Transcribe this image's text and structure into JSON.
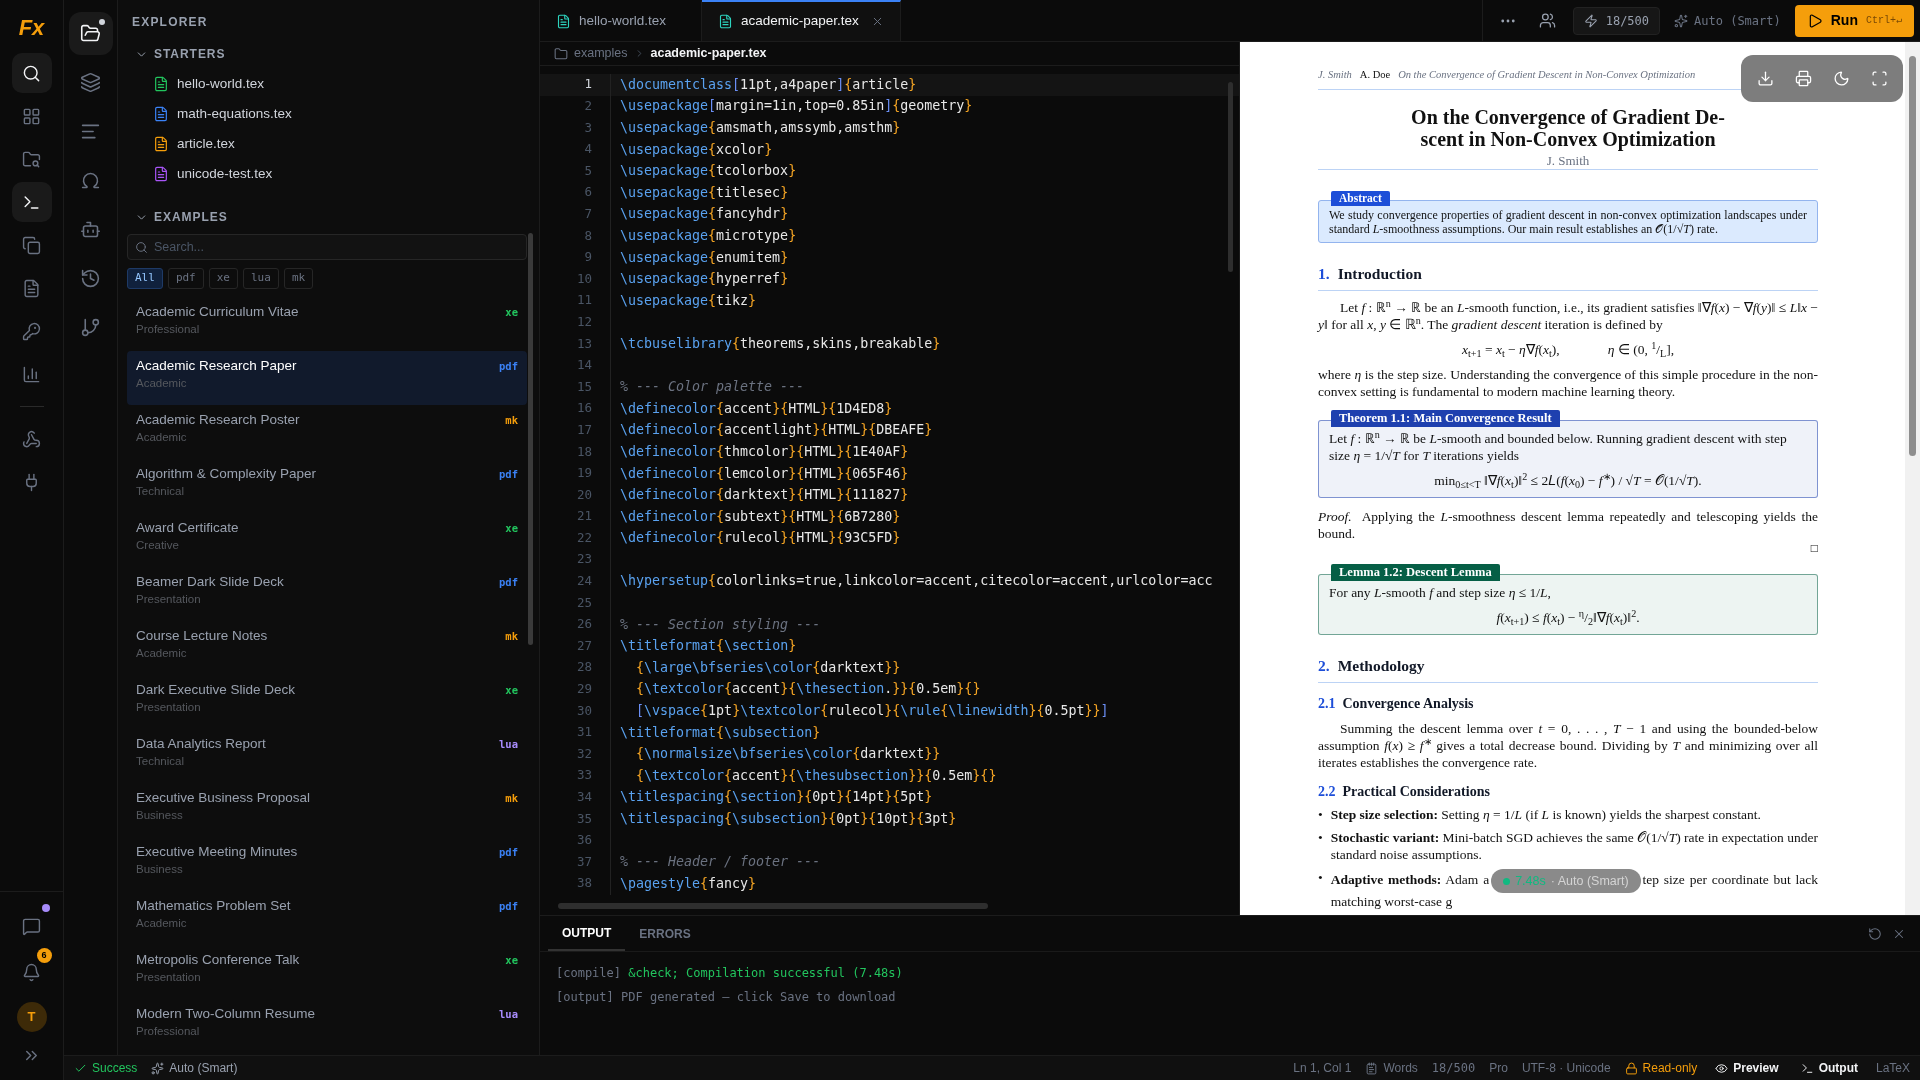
{
  "activity_bar": {
    "logo": "Fx",
    "items": [
      {
        "selected": true
      },
      {
        "selected": false
      },
      {
        "selected": false
      },
      {
        "selected": true
      },
      {
        "selected": false
      },
      {
        "selected": false
      },
      {
        "selected": false
      },
      {
        "selected": false
      },
      {
        "selected": false
      },
      {
        "selected": false
      }
    ],
    "chat_unread": true,
    "notifications": "6",
    "avatar": "T"
  },
  "side_nav": {
    "items": [
      {
        "selected": true,
        "dot": true
      },
      {
        "selected": false,
        "dot": false
      },
      {
        "selected": false,
        "dot": false
      },
      {
        "selected": false,
        "dot": false
      },
      {
        "selected": false,
        "dot": false
      },
      {
        "selected": false,
        "dot": false
      },
      {
        "selected": false,
        "dot": false
      }
    ]
  },
  "explorer": {
    "title": "EXPLORER",
    "starters": {
      "title": "STARTERS",
      "expanded": true,
      "files": [
        {
          "name": "hello-world.tex",
          "color": "#22c55e"
        },
        {
          "name": "math-equations.tex",
          "color": "#3b82f6"
        },
        {
          "name": "article.tex",
          "color": "#f59e0b"
        },
        {
          "name": "unicode-test.tex",
          "color": "#a855f7"
        }
      ]
    },
    "examples": {
      "title": "EXAMPLES",
      "expanded": true,
      "search": {
        "placeholder": "Search..."
      },
      "filters": [
        {
          "label": "All",
          "selected": true
        },
        {
          "label": "pdf",
          "selected": false
        },
        {
          "label": "xe",
          "selected": false
        },
        {
          "label": "lua",
          "selected": false
        },
        {
          "label": "mk",
          "selected": false
        }
      ],
      "items": [
        {
          "title": "Academic Curriculum Vitae",
          "category": "Professional",
          "engine": "xe",
          "color": "#22c55e",
          "selected": false
        },
        {
          "title": "Academic Research Paper",
          "category": "Academic",
          "engine": "pdf",
          "color": "#3b82f6",
          "selected": true
        },
        {
          "title": "Academic Research Poster",
          "category": "Academic",
          "engine": "mk",
          "color": "#f59e0b",
          "selected": false
        },
        {
          "title": "Algorithm & Complexity Paper",
          "category": "Technical",
          "engine": "pdf",
          "color": "#3b82f6",
          "selected": false
        },
        {
          "title": "Award Certificate",
          "category": "Creative",
          "engine": "xe",
          "color": "#22c55e",
          "selected": false
        },
        {
          "title": "Beamer Dark Slide Deck",
          "category": "Presentation",
          "engine": "pdf",
          "color": "#3b82f6",
          "selected": false
        },
        {
          "title": "Course Lecture Notes",
          "category": "Academic",
          "engine": "mk",
          "color": "#f59e0b",
          "selected": false
        },
        {
          "title": "Dark Executive Slide Deck",
          "category": "Presentation",
          "engine": "xe",
          "color": "#22c55e",
          "selected": false
        },
        {
          "title": "Data Analytics Report",
          "category": "Technical",
          "engine": "lua",
          "color": "#a78bfa",
          "selected": false
        },
        {
          "title": "Executive Business Proposal",
          "category": "Business",
          "engine": "mk",
          "color": "#f59e0b",
          "selected": false
        },
        {
          "title": "Executive Meeting Minutes",
          "category": "Business",
          "engine": "pdf",
          "color": "#3b82f6",
          "selected": false
        },
        {
          "title": "Mathematics Problem Set",
          "category": "Academic",
          "engine": "pdf",
          "color": "#3b82f6",
          "selected": false
        },
        {
          "title": "Metropolis Conference Talk",
          "category": "Presentation",
          "engine": "xe",
          "color": "#22c55e",
          "selected": false
        },
        {
          "title": "Modern Two-Column Resume",
          "category": "Professional",
          "engine": "lua",
          "color": "#a78bfa",
          "selected": false
        }
      ]
    }
  },
  "tabs": [
    {
      "label": "hello-world.tex",
      "selected": false,
      "closable": false
    },
    {
      "label": "academic-paper.tex",
      "selected": true,
      "closable": true
    }
  ],
  "toolbar": {
    "usage": "18/500",
    "mode": "Auto (Smart)",
    "run": {
      "label": "Run",
      "shortcut": "Ctrl+↵"
    }
  },
  "breadcrumb": [
    "examples",
    "academic-paper.tex"
  ],
  "editor": {
    "lines": [
      {
        "n": "1",
        "current": true,
        "code": "\\documentclass[11pt,a4paper]{article}"
      },
      {
        "n": "2",
        "current": false,
        "code": "\\usepackage[margin=1in,top=0.85in]{geometry}"
      },
      {
        "n": "3",
        "current": false,
        "code": "\\usepackage{amsmath,amssymb,amsthm}"
      },
      {
        "n": "4",
        "current": false,
        "code": "\\usepackage{xcolor}"
      },
      {
        "n": "5",
        "current": false,
        "code": "\\usepackage{tcolorbox}"
      },
      {
        "n": "6",
        "current": false,
        "code": "\\usepackage{titlesec}"
      },
      {
        "n": "7",
        "current": false,
        "code": "\\usepackage{fancyhdr}"
      },
      {
        "n": "8",
        "current": false,
        "code": "\\usepackage{microtype}"
      },
      {
        "n": "9",
        "current": false,
        "code": "\\usepackage{enumitem}"
      },
      {
        "n": "10",
        "current": false,
        "code": "\\usepackage{hyperref}"
      },
      {
        "n": "11",
        "current": false,
        "code": "\\usepackage{tikz}"
      },
      {
        "n": "12",
        "current": false
      },
      {
        "n": "13",
        "current": false,
        "code": "\\tcbuselibrary{theorems,skins,breakable}"
      },
      {
        "n": "14",
        "current": false
      },
      {
        "n": "15",
        "current": false,
        "code": "% --- Color palette ---"
      },
      {
        "n": "16",
        "current": false,
        "code": "\\definecolor{accent}{HTML}{1D4ED8}"
      },
      {
        "n": "17",
        "current": false,
        "code": "\\definecolor{accentlight}{HTML}{DBEAFE}"
      },
      {
        "n": "18",
        "current": false,
        "code": "\\definecolor{thmcolor}{HTML}{1E40AF}"
      },
      {
        "n": "19",
        "current": false,
        "code": "\\definecolor{lemcolor}{HTML}{065F46}"
      },
      {
        "n": "20",
        "current": false,
        "code": "\\definecolor{darktext}{HTML}{111827}"
      },
      {
        "n": "21",
        "current": false,
        "code": "\\definecolor{subtext}{HTML}{6B7280}"
      },
      {
        "n": "22",
        "current": false,
        "code": "\\definecolor{rulecol}{HTML}{93C5FD}"
      },
      {
        "n": "23",
        "current": false
      },
      {
        "n": "24",
        "current": false,
        "code": "\\hypersetup{colorlinks=true,linkcolor=accent,citecolor=accent,urlcolor=acc"
      },
      {
        "n": "25",
        "current": false
      },
      {
        "n": "26",
        "current": false,
        "code": "% --- Section styling ---"
      },
      {
        "n": "27",
        "current": false,
        "code": "\\titleformat{\\section}"
      },
      {
        "n": "28",
        "current": false,
        "code": "  {\\large\\bfseries\\color{darktext}}"
      },
      {
        "n": "29",
        "current": false,
        "code": "  {\\textcolor{accent}{\\thesection.}}{0.5em}{}"
      },
      {
        "n": "30",
        "current": false,
        "code": "  [\\vspace{1pt}\\textcolor{rulecol}{\\rule{\\linewidth}{0.5pt}}]"
      },
      {
        "n": "31",
        "current": false,
        "code": "\\titleformat{\\subsection}"
      },
      {
        "n": "32",
        "current": false,
        "code": "  {\\normalsize\\bfseries\\color{darktext}}"
      },
      {
        "n": "33",
        "current": false,
        "code": "  {\\textcolor{accent}{\\thesubsection}}{0.5em}{}"
      },
      {
        "n": "34",
        "current": false,
        "code": "\\titlespacing{\\section}{0pt}{14pt}{5pt}"
      },
      {
        "n": "35",
        "current": false,
        "code": "\\titlespacing{\\subsection}{0pt}{10pt}{3pt}"
      },
      {
        "n": "36",
        "current": false
      },
      {
        "n": "37",
        "current": false,
        "code": "% --- Header / footer ---"
      },
      {
        "n": "38",
        "current": false,
        "code": "\\pagestyle{fancy}"
      }
    ]
  },
  "preview": {
    "running_header": {
      "left": "J. Smith",
      "center": "A. Doe",
      "right": "On the Convergence of Gradient Descent in Non-Convex Optimization"
    },
    "title_lines": [
      "On the Convergence of Gradient De-",
      "scent in Non-Convex Optimization"
    ],
    "author": "J. Smith",
    "abstract": {
      "label": "Abstract",
      "text": "We study convergence properties of gradient descent in non-convex optimization landscapes under standard *L*-smoothness assumptions. Our main result establishes an 𝒪(1/√*T*) rate."
    },
    "blocks": [
      {
        "kind": "section",
        "number": "1.",
        "title": "Introduction"
      },
      {
        "kind": "paragraph",
        "indent": true,
        "text": "Let *f* : ℝ$^{n}$ → ℝ be an *L*-smooth function, i.e., its gradient satisfies ‖∇*f*(*x*) − ∇*f*(*y*)‖ ≤ *L*‖*x* − *y*‖ for all *x*, *y* ∈ ℝ$^{n}$. The *gradient descent* iteration is defined by"
      },
      {
        "kind": "equation",
        "parts": [
          "*x*$_{t+1}$ = *x*$_{t}$ − *η*∇*f*(*x*$_{t}$),",
          "*η* ∈ (0, $^{1}$/$_{L}$],"
        ]
      },
      {
        "kind": "paragraph",
        "indent": false,
        "text": "where *η* is the step size. Understanding the convergence of this simple procedure in the non-convex setting is fundamental to modern machine learning theory."
      },
      {
        "kind": "box",
        "label": "Theorem 1.1: Main Convergence Result",
        "color": "#1e40af",
        "text": "Let *f* : ℝ$^{n}$ → ℝ be *L*-smooth and bounded below. Running gradient descent with step size *η* = 1/√*T* for *T* iterations yields",
        "equation": "min$_{0≤t<T}$ ‖∇*f*(*x*$_{t}$)‖$^{2}$ ≤ 2𝐿(*f*(*x*$_{0}$) − *f*$^{∗}$) / √*T* = 𝒪(1/√*T*)."
      },
      {
        "kind": "proof",
        "label": "Proof.",
        "text": "Applying the *L*-smoothness descent lemma repeatedly and telescoping yields the bound.",
        "end": "□"
      },
      {
        "kind": "box",
        "label": "Lemma 1.2: Descent Lemma",
        "color": "#065f46",
        "text": "For any *L*-smooth *f* and step size *η* ≤ 1/*L*,",
        "equation": "*f*(*x*$_{t+1}$) ≤ *f*(*x*$_{t}$) − $^{η}$/$_{2}$‖∇*f*(*x*$_{t}$)‖$^{2}$."
      },
      {
        "kind": "section",
        "number": "2.",
        "title": "Methodology"
      },
      {
        "kind": "subsection",
        "number": "2.1",
        "title": "Convergence Analysis"
      },
      {
        "kind": "paragraph",
        "indent": true,
        "text": "Summing the descent lemma over *t* = 0, . . . , *T* − 1 and using the bounded-below assumption *f*(*x*) ≥ *f*$^{∗}$ gives a total decrease bound. Dividing by *T* and minimizing over all iterates establishes the convergence rate."
      },
      {
        "kind": "subsection",
        "number": "2.2",
        "title": "Practical Considerations"
      },
      {
        "kind": "bullets",
        "marker": "•",
        "items": [
          {
            "term": "Step size selection:",
            "parts": [
              "Setting *η* = 1/*L* (if *L* is known) yields the sharpest constant."
            ]
          },
          {
            "term": "Stochastic variant:",
            "parts": [
              "Mini-batch SGD achieves the same 𝒪(1/√*T*) rate in expectation under standard noise assumptions."
            ]
          },
          {
            "term": "Adaptive methods:",
            "parts": [
              "Adam a",
              "tep size per coordinate but lack matching worst-case g"
            ]
          }
        ]
      }
    ],
    "status_pill": {
      "time": "7.48s",
      "mode": "· Auto (Smart)"
    }
  },
  "output_panel": {
    "tabs": [
      {
        "label": "OUTPUT",
        "selected": true
      },
      {
        "label": "ERRORS",
        "selected": false
      }
    ],
    "lines": [
      {
        "source": "[compile]",
        "message": "&check; Compilation successful (7.48s)",
        "kind": "success"
      },
      {
        "source": "[output]",
        "message": "PDF generated — click Save to download",
        "kind": "info"
      }
    ]
  },
  "status_bar": {
    "left": [
      {
        "kind": "success",
        "label": "Success"
      },
      {
        "kind": "mode",
        "label": "Auto (Smart)"
      }
    ],
    "right": [
      {
        "kind": "plain",
        "label": "Ln 1, Col 1"
      },
      {
        "kind": "words",
        "label": "Words"
      },
      {
        "kind": "mono",
        "label": "18/500"
      },
      {
        "kind": "plain",
        "label": "Pro"
      },
      {
        "kind": "plain",
        "label": "UTF-8 · Unicode"
      },
      {
        "kind": "readonly",
        "label": "Read-only"
      },
      {
        "kind": "preview",
        "label": "Preview"
      },
      {
        "kind": "output",
        "label": "Output"
      },
      {
        "kind": "plain",
        "label": "LaTeX"
      }
    ]
  }
}
